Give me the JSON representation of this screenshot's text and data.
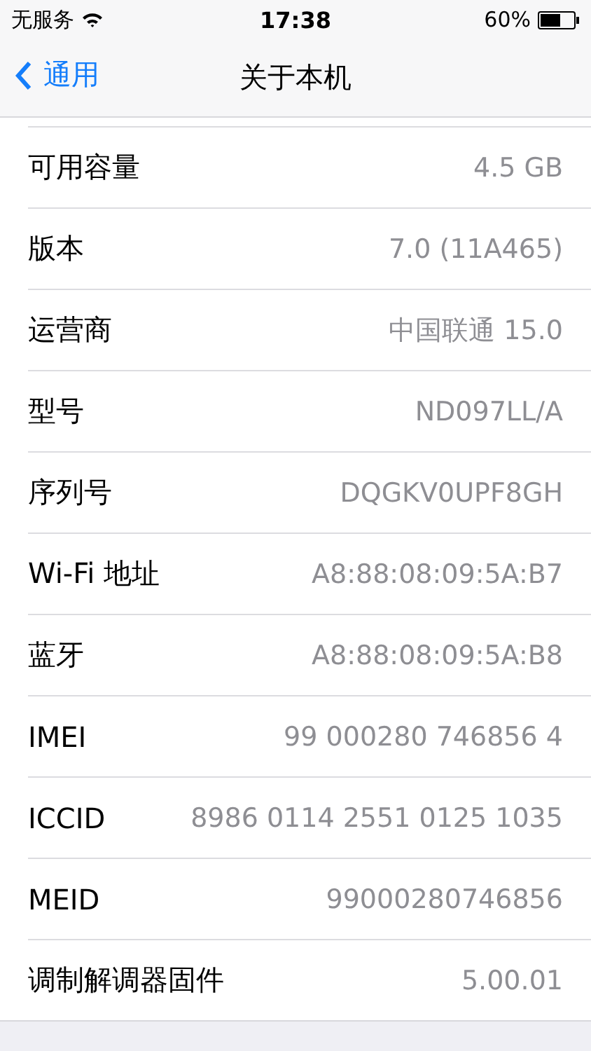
{
  "status_bar": {
    "carrier": "无服务",
    "time": "17:38",
    "battery": "60%"
  },
  "nav_bar": {
    "back": "通用",
    "title": "关于本机"
  },
  "rows": [
    {
      "label": "可用容量",
      "value": "4.5 GB"
    },
    {
      "label": "版本",
      "value": "7.0 (11A465)"
    },
    {
      "label": "运营商",
      "value": "中国联通 15.0"
    },
    {
      "label": "型号",
      "value": "ND097LL/A"
    },
    {
      "label": "序列号",
      "value": "DQGKV0UPF8GH"
    },
    {
      "label": "Wi-Fi 地址",
      "value": "A8:88:08:09:5A:B7"
    },
    {
      "label": "蓝牙",
      "value": "A8:88:08:09:5A:B8"
    },
    {
      "label": "IMEI",
      "value": "99 000280 746856 4"
    },
    {
      "label": "ICCID",
      "value": "8986 0114 2551 0125 1035"
    },
    {
      "label": "MEID",
      "value": "99000280746856"
    },
    {
      "label": "调制解调器固件",
      "value": "5.00.01"
    }
  ]
}
